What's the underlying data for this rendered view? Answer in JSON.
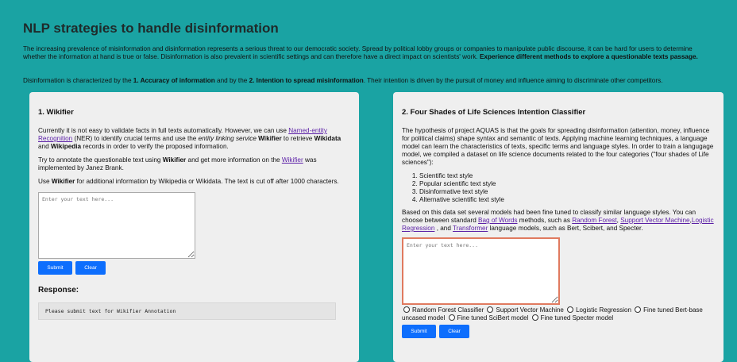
{
  "page": {
    "title": "NLP strategies to handle disinformation",
    "intro_text": "The increasing prevalence of misinformation and disinformation represents a serious threat to our democratic society. Spread by political lobby groups or companies to manipulate public discourse, it can be hard for users to determine whether the information at hand is true or false. Disinformation is also prevalent in scientific settings and can therefore have a direct impact on scientists' work. ",
    "intro_bold": "Experience different methods to explore a questionable texts passage.",
    "intro2_a": "Disinformation is characterized by the ",
    "intro2_b": "1. Accuracy of information",
    "intro2_c": " and by the ",
    "intro2_d": "2. Intention to spread misinformation",
    "intro2_e": ". Their intention is driven by the pursuit of money and influence aiming to discriminate other competitors."
  },
  "wikifier": {
    "heading": "1. Wikifier",
    "p1_a": "Currently it is not easy to validate facts in full texts automatically. However, we can use ",
    "p1_link": "Named-entity Recognition",
    "p1_b": " (NER) to identify crucial terms and use the ",
    "p1_em": "entity linking service",
    "p1_c": " ",
    "p1_bold1": "Wikifier",
    "p1_d": " to retrieve ",
    "p1_bold2": "Wikidata",
    "p1_e": " and ",
    "p1_bold3": "Wikipedia",
    "p1_f": " records in order to verify the proposed information.",
    "p2_a": "Try to annotate the questionable text using ",
    "p2_bold": "Wikifier",
    "p2_b": " and get more information on the ",
    "p2_link": "Wikifier",
    "p2_c": " was implemented by Janez Brank.",
    "p3_a": "Use ",
    "p3_bold": "Wikifier",
    "p3_b": " for additional information by Wikipedia or Wikidata. The text is cut off after 1000 characters.",
    "textarea_placeholder": "Enter your text here...",
    "submit_label": "Submit",
    "clear_label": "Clear",
    "response_heading": "Response:",
    "response_text": "Please submit text for Wikifier Annotation"
  },
  "classifier": {
    "heading": "2. Four Shades of Life Sciences Intention Classifier",
    "p1": "The hypothesis of project AQUAS is that the goals for spreading disinformation (attention, money, influence for political claims) shape syntax and semantic of texts. Applying machine learning techniques, a language model can learn the characteristics of texts, specific terms and language styles. In order to train a langugage model, we compiled a dataset on life science documents related to the four categories (\"four shades of Life sciences\"):",
    "categories": [
      "Scientific text style",
      "Popular scientific text style",
      "Disinformative text style",
      "Alternative scientific text style"
    ],
    "p2_a": "Based on this data set several models had been fine tuned to classify similar language styles. You can choose between standard ",
    "link_bow": "Bag of Words",
    "p2_b": " methods, such as ",
    "link_rf": "Random Forest",
    "p2_c": ", ",
    "link_svm": "Support Vector Machine",
    "p2_d": ",",
    "link_lr": "Logistic Regression",
    "p2_e": " , and ",
    "link_tf": "Transformer",
    "p2_f": " language models, such as Bert, Scibert, and Specter.",
    "textarea_placeholder": "Enter your text here...",
    "models": [
      "Random Forest Classifier",
      "Support Vector Machine",
      "Logistic Regression",
      "Fine tuned Bert-base uncased model",
      "Fine tuned SciBert model",
      "Fine tuned Specter model"
    ],
    "submit_label": "Submit",
    "clear_label": "Clear"
  },
  "colors": {
    "background": "#1aa3a3",
    "card": "#efefef",
    "button": "#0d6efd",
    "link": "#5b1fa6",
    "focus_border": "#e07a5f"
  }
}
